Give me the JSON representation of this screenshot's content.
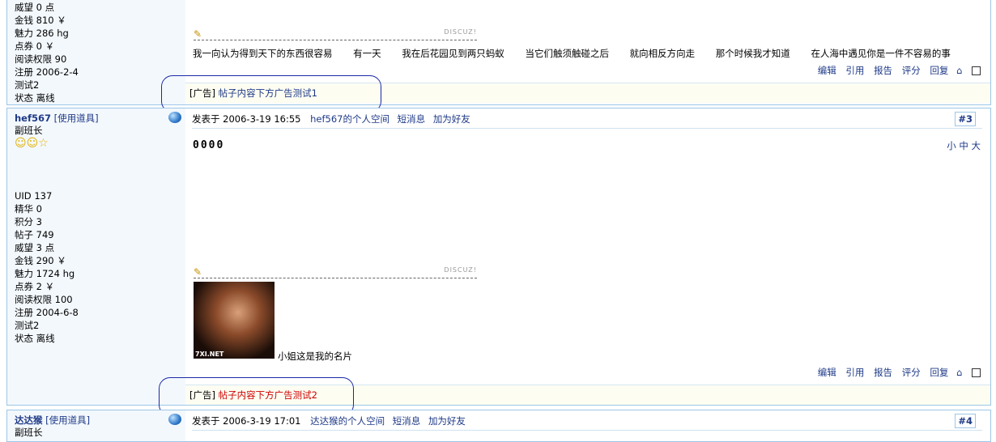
{
  "post1": {
    "stats": [
      "威望 0 点",
      "金钱 810 ￥",
      "魅力 286 hg",
      "点券 0 ￥",
      "阅读权限 90",
      "注册 2006-2-4",
      "测试2",
      "状态 离线"
    ],
    "signature_text": [
      "我一向认为得到天下的东西很容易",
      "有一天",
      "我在后花园见到两只蚂蚁",
      "当它们触须触碰之后",
      "就向相反方向走",
      "那个时候我才知道",
      "在人海中遇见你是一件不容易的事"
    ],
    "discuz_mark": "DISCUZ!",
    "ad_prefix": "[广告]",
    "ad_text": "帖子内容下方广告测试1"
  },
  "post2": {
    "username": "hef567",
    "tools": "[使用道具]",
    "rank": "副班长",
    "stats": [
      "UID 137",
      "精华 0",
      "积分 3",
      "帖子 749",
      "威望 3 点",
      "金钱 290 ￥",
      "魅力 1724 hg",
      "点券 2 ￥",
      "阅读权限 100",
      "注册 2004-6-8",
      "测试2",
      "状态 离线"
    ],
    "posted": "发表于 2006-3-19 16:55",
    "space": "hef567的个人空间",
    "pm": "短消息",
    "friend": "加为好友",
    "floor": "#3",
    "content": "0000",
    "size_small": "小",
    "size_mid": "中",
    "size_large": "大",
    "discuz_mark": "DISCUZ!",
    "caption": "小姐这是我的名片",
    "photo_text": "7XI.NET",
    "ad_prefix": "[广告]",
    "ad_text": "帖子内容下方广告测试2"
  },
  "post3": {
    "username": "达达猴",
    "tools": "[使用道具]",
    "rank": "副班长",
    "posted": "发表于 2006-3-19 17:01",
    "space": "达达猴的个人空间",
    "pm": "短消息",
    "friend": "加为好友",
    "floor": "#4"
  },
  "ops": {
    "edit": "编辑",
    "quote": "引用",
    "report": "报告",
    "rate": "评分",
    "reply": "回复"
  },
  "colors": {
    "ad_link1": "#1f3a87",
    "ad_link2": "#cc0000",
    "circle": "#1a2aa5"
  }
}
